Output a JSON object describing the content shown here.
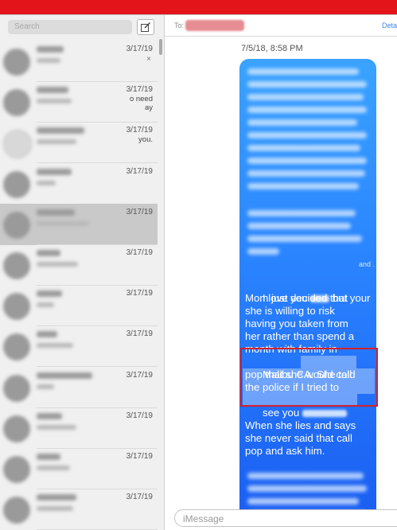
{
  "colors": {
    "accent_bar": "#e4141b",
    "bubble": "#2b86ff",
    "highlight": "#d3202a",
    "link": "#3f82f0"
  },
  "sidebar": {
    "search_placeholder": "Search",
    "compose_icon": "compose-icon",
    "conversations": [
      {
        "date": "3/17/19",
        "preview": "",
        "show_close": true,
        "selected": false
      },
      {
        "date": "3/17/19",
        "preview": "o need\nay",
        "show_close": false,
        "selected": false
      },
      {
        "date": "3/17/19",
        "preview": "you.",
        "show_close": false,
        "selected": false
      },
      {
        "date": "3/17/19",
        "preview": "",
        "show_close": false,
        "selected": false
      },
      {
        "date": "3/17/19",
        "preview": "",
        "show_close": false,
        "selected": true
      },
      {
        "date": "3/17/19",
        "preview": "",
        "show_close": false,
        "selected": false
      },
      {
        "date": "3/17/19",
        "preview": "",
        "show_close": false,
        "selected": false
      },
      {
        "date": "3/17/19",
        "preview": "",
        "show_close": false,
        "selected": false
      },
      {
        "date": "3/17/19",
        "preview": "",
        "show_close": false,
        "selected": false
      },
      {
        "date": "3/17/19",
        "preview": "",
        "show_close": false,
        "selected": false
      },
      {
        "date": "3/17/19",
        "preview": "",
        "show_close": false,
        "selected": false
      },
      {
        "date": "3/17/19",
        "preview": "",
        "show_close": false,
        "selected": false
      }
    ],
    "close_glyph": "×"
  },
  "header": {
    "to_label": "To:",
    "details_label": "Deta"
  },
  "conversation": {
    "timestamp": "7/5/18, 8:58 PM",
    "message_visible": {
      "line1_a": "I love you ",
      "line1_b": " but your",
      "line2": "Mom just decided that",
      "line3": "she is willing to risk",
      "line4": "having you taken from",
      "line5": "her rather than spend a",
      "line6": "month with family in",
      "line7_a": "Malibu CA. ",
      "line7_b": "She told",
      "line8": "pop that she would call",
      "line9": "the police if I tried to",
      "line10": "see you",
      "para2_line1": "When she lies and says",
      "para2_line2": "she never said that call",
      "para2_line3": "pop and ask him.",
      "ellipsis": "and ."
    }
  },
  "input": {
    "placeholder": "iMessage"
  }
}
